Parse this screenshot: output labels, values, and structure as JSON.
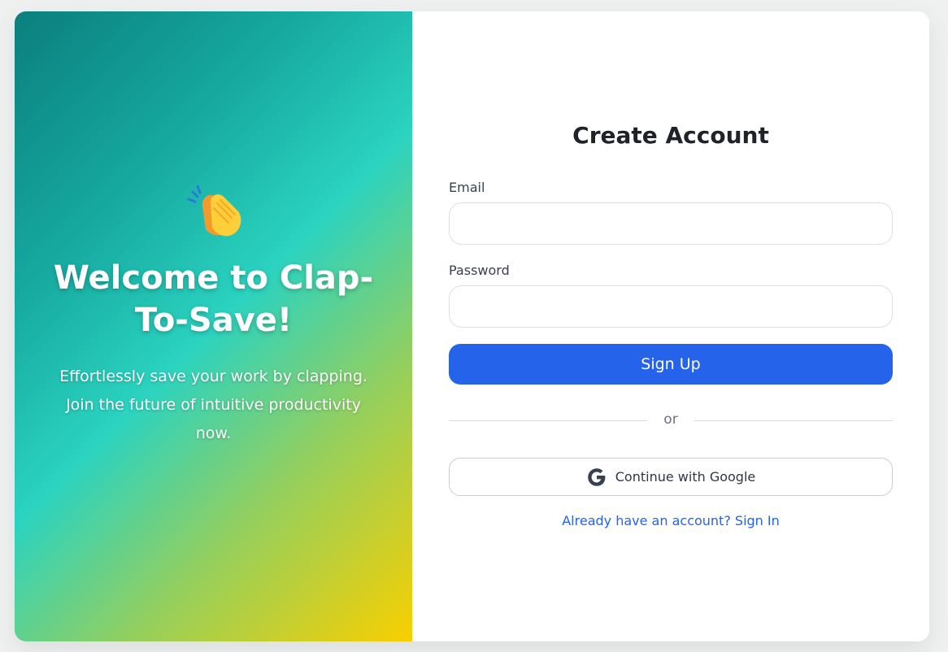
{
  "hero": {
    "emoji_icon": "clapping-hands-icon",
    "title": "Welcome to Clap-To-Save!",
    "subtitle": "Effortlessly save your work by clapping. Join the future of intuitive productivity now."
  },
  "form": {
    "title": "Create Account",
    "email_label": "Email",
    "email_value": "",
    "password_label": "Password",
    "password_value": "",
    "submit_label": "Sign Up",
    "divider_text": "or",
    "google_label": "Continue with Google",
    "signin_link": "Already have an account? Sign In"
  },
  "colors": {
    "primary": "#2563eb",
    "gradient_start": "#0b7f7e",
    "gradient_mid": "#2bd3c0",
    "gradient_end": "#f9cf00"
  }
}
